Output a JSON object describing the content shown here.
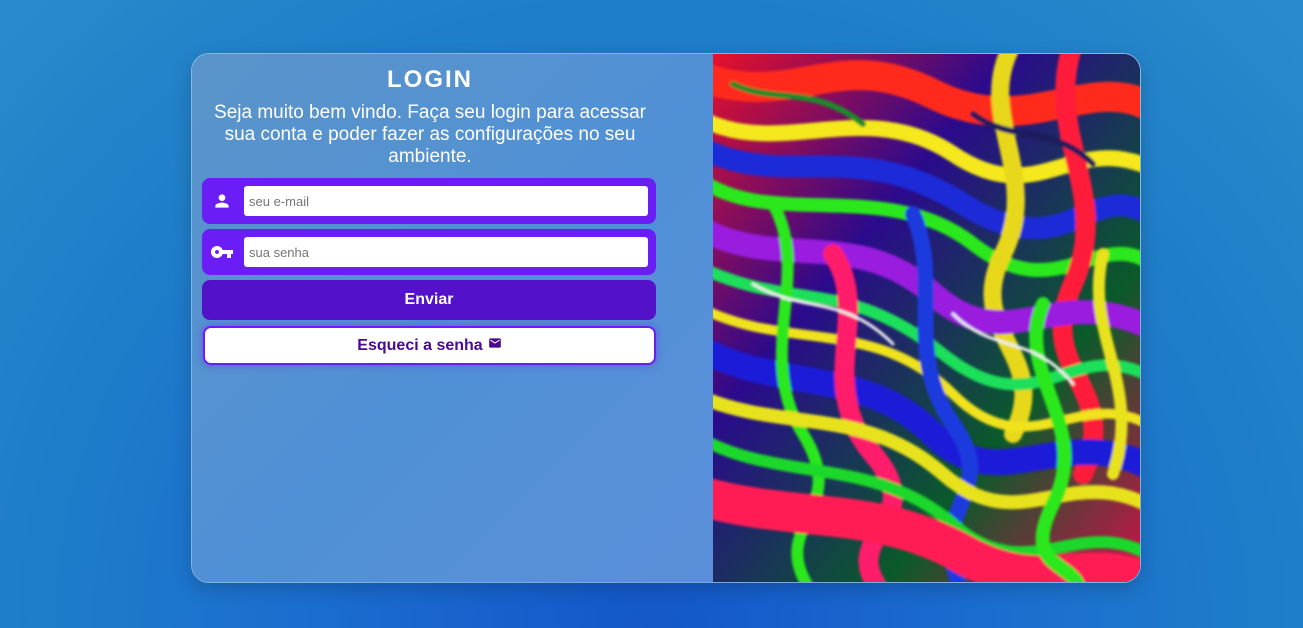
{
  "login": {
    "title": "LOGIN",
    "subtitle": "Seja muito bem vindo. Faça seu login para acessar sua conta e poder fazer as configurações no seu ambiente.",
    "email": {
      "placeholder": "seu e-mail",
      "icon": "person-icon"
    },
    "password": {
      "placeholder": "sua senha",
      "icon": "key-icon"
    },
    "submit_label": "Enviar",
    "forgot_label": "Esqueci a senha",
    "forgot_icon": "mail-icon"
  },
  "decorative_image": {
    "description_icon": "fluid-art-image"
  },
  "colors": {
    "field_bg": "#6a1ef5",
    "button_bg": "#5311c9",
    "forgot_text": "#4a0a8f",
    "panel_bg": "#5090d6"
  }
}
